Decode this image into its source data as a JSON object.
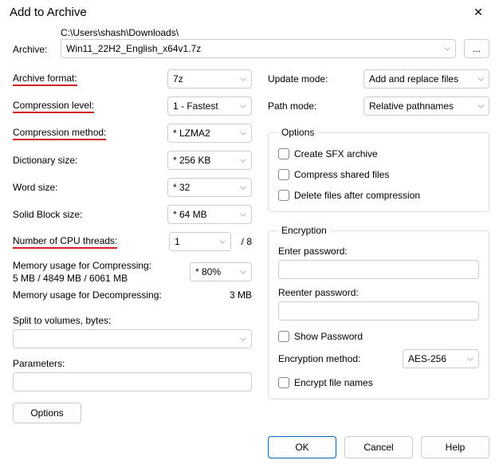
{
  "title": "Add to Archive",
  "closeGlyph": "✕",
  "archive": {
    "label": "Archive:",
    "path": "C:\\Users\\shash\\Downloads\\",
    "file": "Win11_22H2_English_x64v1.7z",
    "browse": "..."
  },
  "left": {
    "format": {
      "label": "Archive format:",
      "value": "7z"
    },
    "level": {
      "label": "Compression level:",
      "value": "1 - Fastest"
    },
    "method": {
      "label": "Compression method:",
      "value": "* LZMA2"
    },
    "dict": {
      "label": "Dictionary size:",
      "value": "* 256 KB"
    },
    "word": {
      "label": "Word size:",
      "value": "* 32"
    },
    "block": {
      "label": "Solid Block size:",
      "value": "* 64 MB"
    },
    "cpu": {
      "label": "Number of CPU threads:",
      "value": "1",
      "suffix": "/ 8"
    },
    "memc_label": "Memory usage for Compressing:",
    "memc_value": "5 MB / 4849 MB / 6061 MB",
    "memc_combo": "* 80%",
    "memd_label": "Memory usage for Decompressing:",
    "memd_value": "3 MB",
    "split_label": "Split to volumes, bytes:",
    "split_value": "",
    "params_label": "Parameters:",
    "params_value": "",
    "options_btn": "Options"
  },
  "right": {
    "update": {
      "label": "Update mode:",
      "value": "Add and replace files"
    },
    "pathmode": {
      "label": "Path mode:",
      "value": "Relative pathnames"
    },
    "options_legend": "Options",
    "opt_sfx": "Create SFX archive",
    "opt_shared": "Compress shared files",
    "opt_delete": "Delete files after compression",
    "enc_legend": "Encryption",
    "enter_pwd": "Enter password:",
    "reenter_pwd": "Reenter password:",
    "show_pwd": "Show Password",
    "enc_method_label": "Encryption method:",
    "enc_method_value": "AES-256",
    "encrypt_names": "Encrypt file names"
  },
  "footer": {
    "ok": "OK",
    "cancel": "Cancel",
    "help": "Help"
  },
  "arrow": "⌵"
}
